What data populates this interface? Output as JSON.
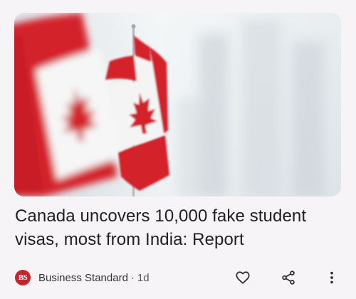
{
  "article": {
    "headline": "Canada uncovers 10,000 fake student visas, most from India: Report",
    "source": "Business Standard",
    "separator": "·",
    "age": "1d",
    "source_logo_text": "BS"
  },
  "colors": {
    "flag_red": "#d3202b",
    "logo_red": "#c0262d",
    "text": "#1f1f1f",
    "background": "#f7f4f8"
  },
  "icons": {
    "like": "heart-icon",
    "share": "share-icon",
    "more": "more-vert-icon"
  }
}
